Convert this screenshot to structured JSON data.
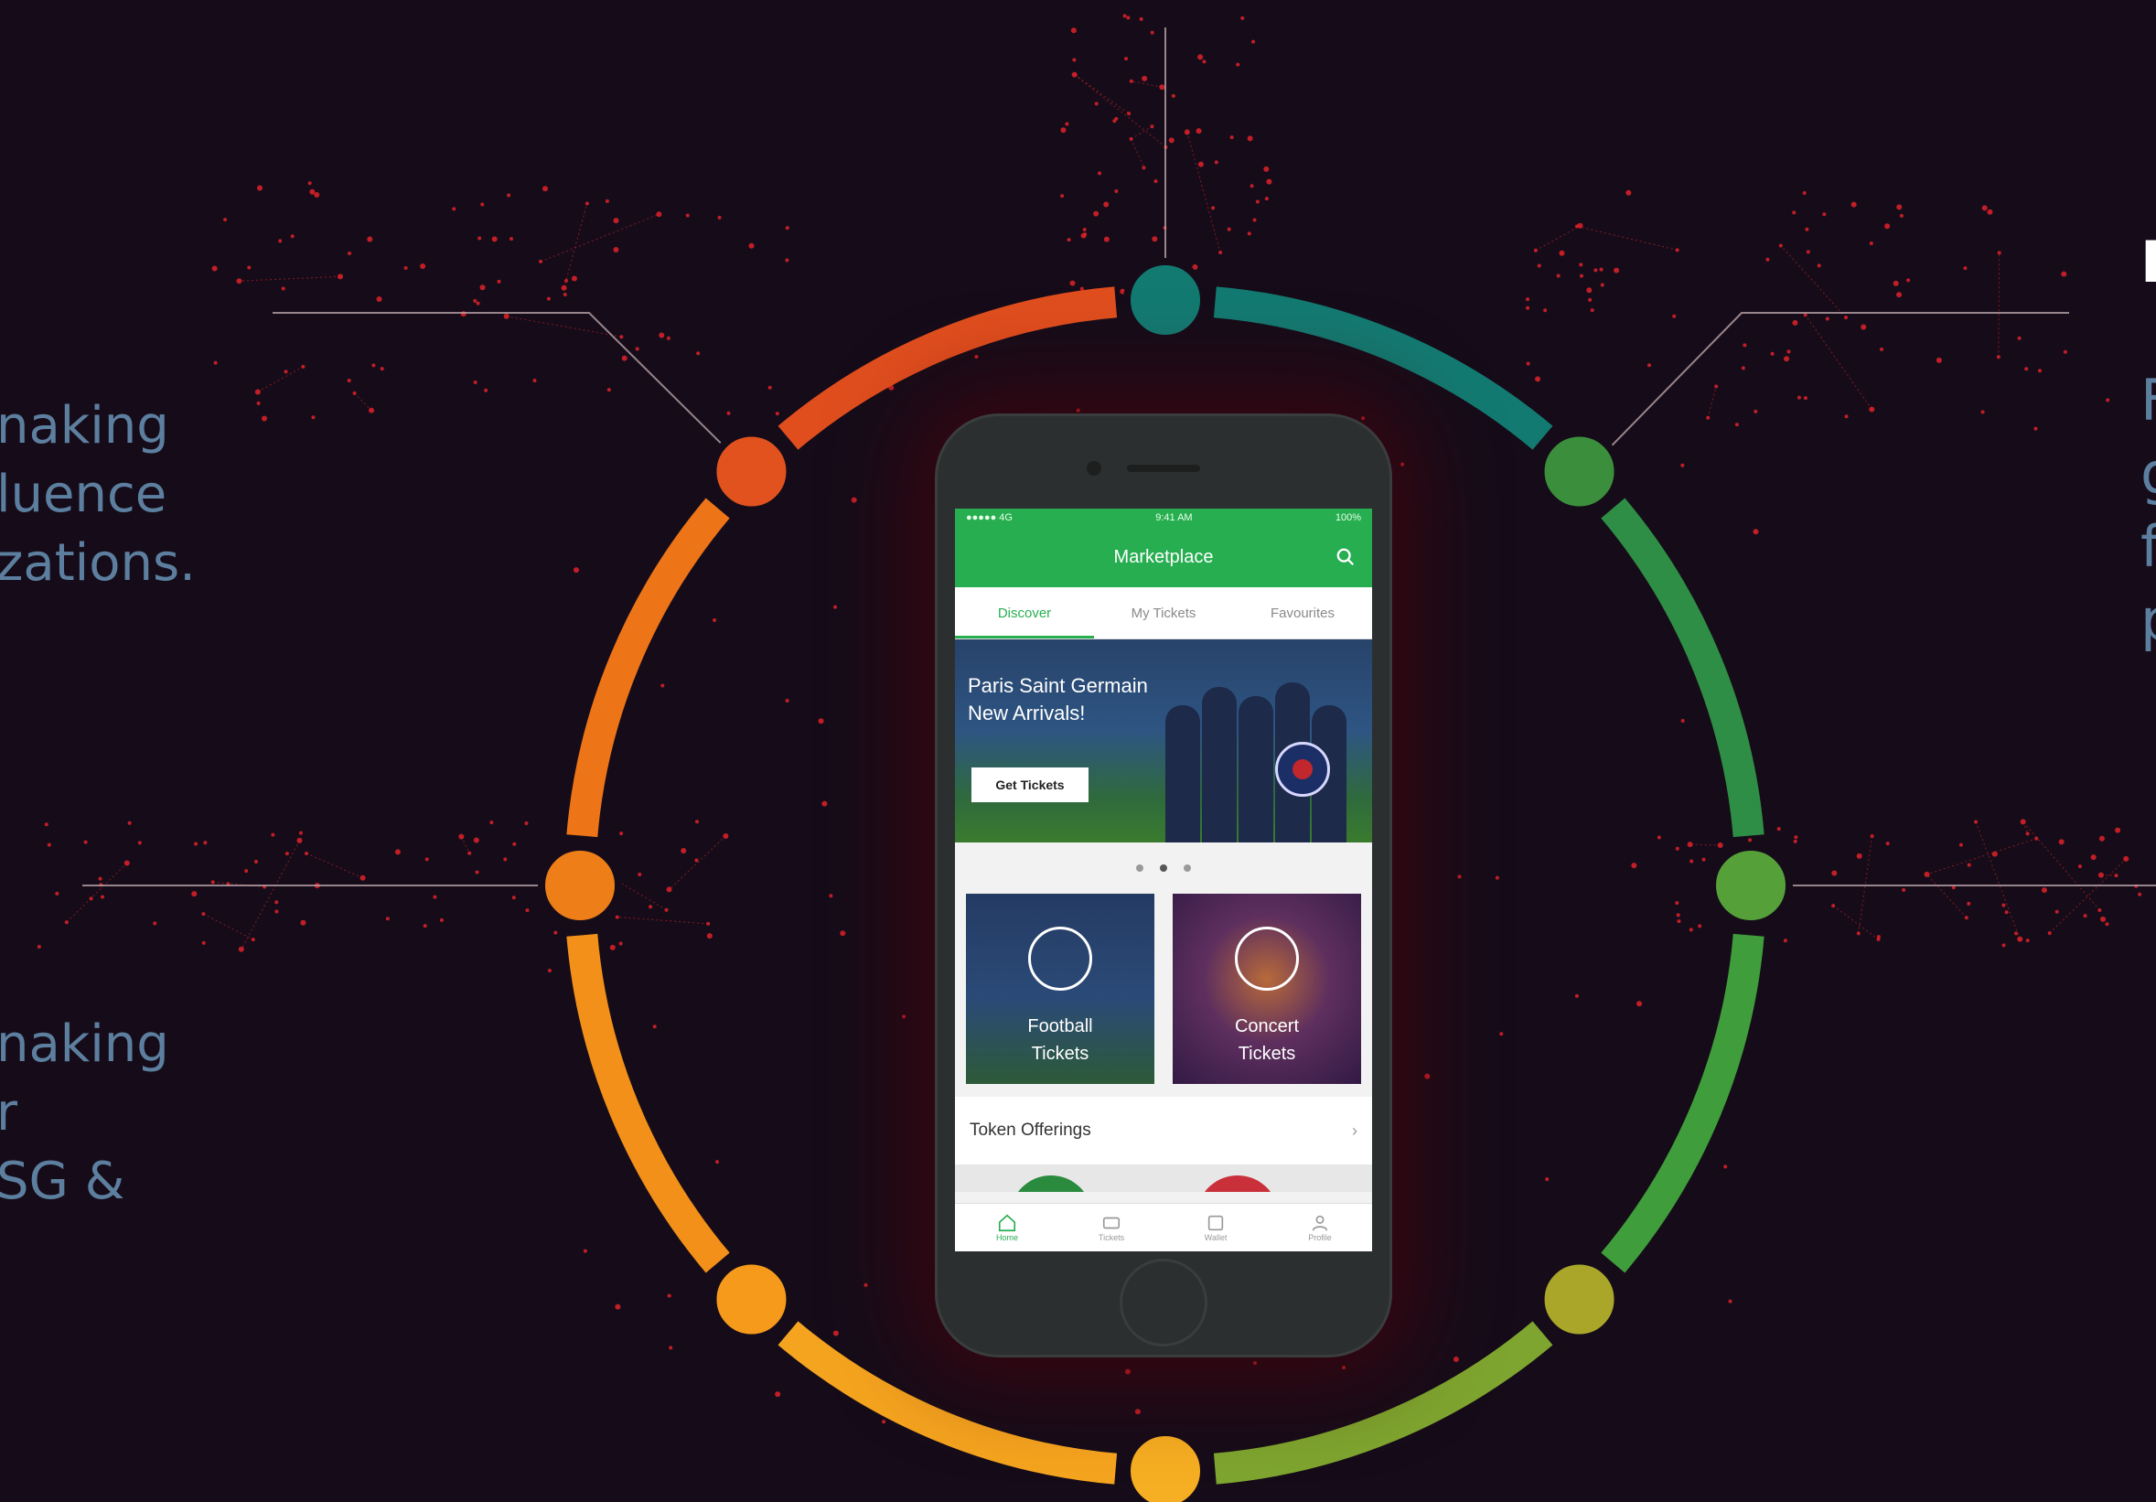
{
  "left_text": {
    "top": "naking\nluence\nzations.",
    "bottom": "naking\nr\nSG &"
  },
  "right_text": {
    "title": "I",
    "body": "F\ng\nf\np"
  },
  "colors": {
    "background": "#160c19",
    "network_red": "#e0222a",
    "ring_start": "#e04e1e",
    "ring_teal": "#137a72",
    "ring_green": "#3f9d3b",
    "app_green": "#27ae51"
  },
  "app": {
    "status_left": "●●●●● 4G",
    "status_center": "9:41 AM",
    "status_right": "100%",
    "title": "Marketplace",
    "search_icon": "search-icon",
    "tabs": [
      {
        "label": "Discover",
        "active": true
      },
      {
        "label": "My Tickets",
        "active": false
      },
      {
        "label": "Favourites",
        "active": false
      }
    ],
    "hero": {
      "title": "Paris Saint Germain New Arrivals!",
      "button": "Get Tickets"
    },
    "categories": [
      {
        "label": "Football\nTickets",
        "icon": "football-icon"
      },
      {
        "label": "Concert\nTickets",
        "icon": "concert-icon"
      }
    ],
    "offerings": {
      "title": "Token Offerings",
      "chevron": "›"
    },
    "bottom_nav": [
      {
        "label": "Home",
        "icon": "home-icon",
        "active": true
      },
      {
        "label": "Tickets",
        "icon": "ticket-icon",
        "active": false
      },
      {
        "label": "Wallet",
        "icon": "wallet-icon",
        "active": false
      },
      {
        "label": "Profile",
        "icon": "profile-icon",
        "active": false
      }
    ]
  }
}
